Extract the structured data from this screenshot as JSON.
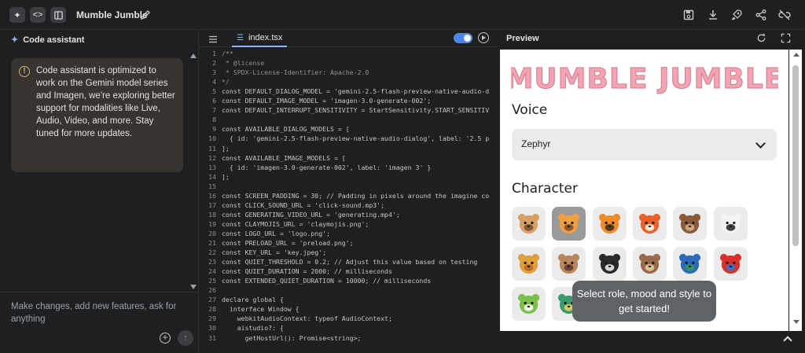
{
  "app": {
    "title": "Mumble Jumble"
  },
  "assistant": {
    "header": "Code assistant",
    "notice": "Code assistant is optimized to work on the Gemini model series and Imagen, we're exploring better support for modalities like Live, Audio, Video, and more. Stay tuned for more updates.",
    "prompt_placeholder": "Make changes, add new features, ask for anything"
  },
  "editor": {
    "tab": "index.tsx",
    "lines": [
      {
        "n": "1",
        "t": "/**",
        "k": "cm"
      },
      {
        "n": "2",
        "t": " * @license",
        "k": "cm"
      },
      {
        "n": "3",
        "t": " * SPDX-License-Identifier: Apache-2.0",
        "k": "cm"
      },
      {
        "n": "4",
        "t": "*/",
        "k": "cm"
      },
      {
        "n": "5",
        "t": "const DEFAULT_DIALOG_MODEL = 'gemini-2.5-flash-preview-native-audio-d",
        "k": ""
      },
      {
        "n": "6",
        "t": "const DEFAULT_IMAGE_MODEL = 'imagen-3.0-generate-002';",
        "k": ""
      },
      {
        "n": "7",
        "t": "const DEFAULT_INTERRUPT_SENSITIVITY = StartSensitivity.START_SENSITIV",
        "k": ""
      },
      {
        "n": "8",
        "t": "",
        "k": ""
      },
      {
        "n": "9",
        "t": "const AVAILABLE_DIALOG_MODELS = [",
        "k": ""
      },
      {
        "n": "10",
        "t": "  { id: 'gemini-2.5-flash-preview-native-audio-dialog', label: '2.5 p",
        "k": ""
      },
      {
        "n": "11",
        "t": "];",
        "k": ""
      },
      {
        "n": "12",
        "t": "const AVAILABLE_IMAGE_MODELS = [",
        "k": ""
      },
      {
        "n": "13",
        "t": "  { id: 'imagen-3.0-generate-002', label: 'imagen 3' }",
        "k": ""
      },
      {
        "n": "14",
        "t": "];",
        "k": ""
      },
      {
        "n": "15",
        "t": "",
        "k": ""
      },
      {
        "n": "16",
        "t": "const SCREEN_PADDING = 30; // Padding in pixels around the imagine co",
        "k": ""
      },
      {
        "n": "17",
        "t": "const CLICK_SOUND_URL = 'click-sound.mp3';",
        "k": ""
      },
      {
        "n": "18",
        "t": "const GENERATING_VIDEO_URL = 'generating.mp4';",
        "k": ""
      },
      {
        "n": "19",
        "t": "const CLAYMOJIS_URL = 'claymojis.png';",
        "k": ""
      },
      {
        "n": "20",
        "t": "const LOGO_URL = 'logo.png';",
        "k": ""
      },
      {
        "n": "21",
        "t": "const PRELOAD_URL = 'preload.png';",
        "k": ""
      },
      {
        "n": "22",
        "t": "const KEY_URL = 'key.jpeg';",
        "k": ""
      },
      {
        "n": "23",
        "t": "const QUIET_THRESHOLD = 0.2; // Adjust this value based on testing",
        "k": ""
      },
      {
        "n": "24",
        "t": "const QUIET_DURATION = 2000; // milliseconds",
        "k": ""
      },
      {
        "n": "25",
        "t": "const EXTENDED_QUIET_DURATION = 10000; // milliseconds",
        "k": ""
      },
      {
        "n": "26",
        "t": "",
        "k": ""
      },
      {
        "n": "27",
        "t": "declare global {",
        "k": ""
      },
      {
        "n": "28",
        "t": "  interface Window {",
        "k": ""
      },
      {
        "n": "29",
        "t": "    webkitAudioContext: typeof AudioContext;",
        "k": ""
      },
      {
        "n": "30",
        "t": "    aistudio?: {",
        "k": ""
      },
      {
        "n": "31",
        "t": "      getHostUrl(): Promise<string>;",
        "k": ""
      }
    ]
  },
  "preview": {
    "header": "Preview",
    "logo_text": "MUMBLE JUMBLE",
    "voice_label": "Voice",
    "voice_value": "Zephyr",
    "character_label": "Character",
    "toast": "Select role, mood and style to get started!",
    "characters": [
      {
        "name": "dog",
        "c1": "#d9a066",
        "c2": "#7a4a2a",
        "selected": false
      },
      {
        "name": "cat",
        "c1": "#f0a040",
        "c2": "#7a4a2a",
        "selected": true
      },
      {
        "name": "tiger",
        "c1": "#f08a2a",
        "c2": "#3a2a1a",
        "selected": false
      },
      {
        "name": "fox",
        "c1": "#e8602a",
        "c2": "#ffffff",
        "selected": false
      },
      {
        "name": "bear",
        "c1": "#8a5a3a",
        "c2": "#d9b48a",
        "selected": false
      },
      {
        "name": "panda",
        "c1": "#f4f4f4",
        "c2": "#222222",
        "selected": false
      },
      {
        "name": "lion",
        "c1": "#e0a040",
        "c2": "#b8641e",
        "selected": false
      },
      {
        "name": "sloth",
        "c1": "#b8865a",
        "c2": "#5a3a2a",
        "selected": false
      },
      {
        "name": "skunk",
        "c1": "#2a2a2a",
        "c2": "#f4f4f4",
        "selected": false
      },
      {
        "name": "owl",
        "c1": "#9a6a4a",
        "c2": "#e8d0a0",
        "selected": false
      },
      {
        "name": "peacock",
        "c1": "#2a6ab8",
        "c2": "#3a9a5a",
        "selected": false
      },
      {
        "name": "parrot",
        "c1": "#d8302a",
        "c2": "#2a7ad8",
        "selected": false
      },
      {
        "name": "frog",
        "c1": "#7ac04a",
        "c2": "#ffffff",
        "selected": false
      },
      {
        "name": "dinosaur",
        "c1": "#3a9a6a",
        "c2": "#f0d060",
        "selected": false
      }
    ]
  }
}
